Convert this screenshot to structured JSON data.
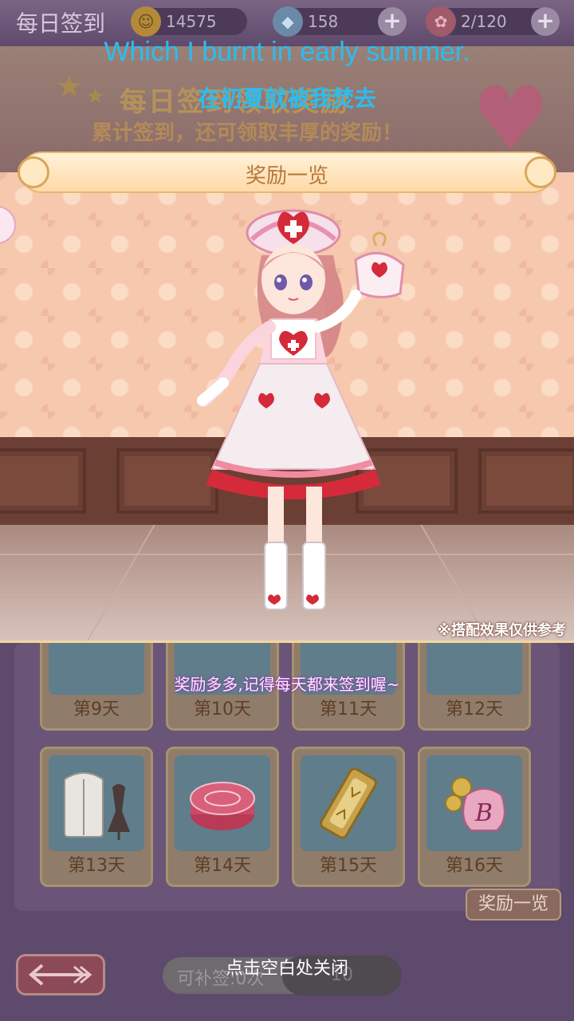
{
  "header": {
    "title": "每日签到",
    "coins": "14575",
    "diamonds": "158",
    "roses": "2/120",
    "coin_icon": "coin-icon",
    "diamond_icon": "diamond-icon",
    "rose_icon": "rose-icon"
  },
  "banner": {
    "line1": "每日签到领取奖励",
    "line2": "累计签到，还可领取丰厚的奖励！"
  },
  "subtitles": {
    "english": "Which I burnt in early summer.",
    "chinese": "在初夏就被我焚去"
  },
  "preview": {
    "title": "奖励一览",
    "disclaimer": "※搭配效果仅供参考"
  },
  "hint": "奖励多多,记得每天都来签到喔~",
  "days": [
    {
      "label": "第9天",
      "icon": "coin-bag-icon"
    },
    {
      "label": "第10天",
      "icon": "gift-icon"
    },
    {
      "label": "第11天",
      "icon": "mirror-icon"
    },
    {
      "label": "第12天",
      "icon": "mirror-icon"
    },
    {
      "label": "第13天",
      "icon": "wardrobe-icon"
    },
    {
      "label": "第14天",
      "icon": "macaron-icon"
    },
    {
      "label": "第15天",
      "icon": "mirror-icon"
    },
    {
      "label": "第16天",
      "icon": "coin-bag-icon"
    }
  ],
  "overview_button": "奖励一览",
  "bottom": {
    "makeup_label": "可补签:0次",
    "makeup_cost": "10",
    "close_hint": "点击空白处关闭"
  },
  "colors": {
    "subtitle": "#2bbdf0",
    "ribbon_text": "#b67838",
    "wall": "#f6c8ae"
  }
}
